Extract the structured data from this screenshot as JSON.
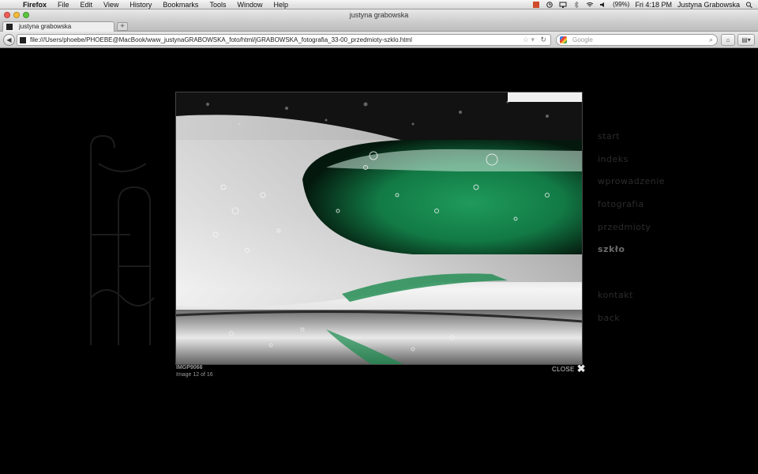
{
  "menubar": {
    "app": "Firefox",
    "items": [
      "File",
      "Edit",
      "View",
      "History",
      "Bookmarks",
      "Tools",
      "Window",
      "Help"
    ],
    "battery": "(99%)",
    "clock": "Fri 4:18 PM",
    "user": "Justyna Grabowska"
  },
  "window": {
    "title": "justyna grabowska"
  },
  "tab": {
    "label": "justyna grabowska",
    "new_tab": "+"
  },
  "nav": {
    "url": "file:///Users/phoebe/PHOEBE@MacBook/www_justynaGRABOWSKA_foto/html/jGRABOWSKA_fotografia_33-00_przedmioty-szklo.html",
    "search_placeholder": "Google"
  },
  "page": {
    "caption_title": "IMGP9066",
    "caption_count": "Image 12 of 16",
    "close_label": "CLOSE",
    "close_glyph": "✖",
    "menu": [
      {
        "label": "start",
        "active": false
      },
      {
        "label": "indeks",
        "active": false
      },
      {
        "label": "wprowadzenie",
        "active": false
      },
      {
        "label": "fotografia",
        "active": false
      },
      {
        "label": "przedmioty",
        "active": false
      },
      {
        "label": "szkło",
        "active": true
      }
    ],
    "menu_bottom": [
      {
        "label": "kontakt"
      },
      {
        "label": "back"
      }
    ]
  },
  "colors": {
    "background": "#000000",
    "glass_green": "#1f9a5c"
  }
}
